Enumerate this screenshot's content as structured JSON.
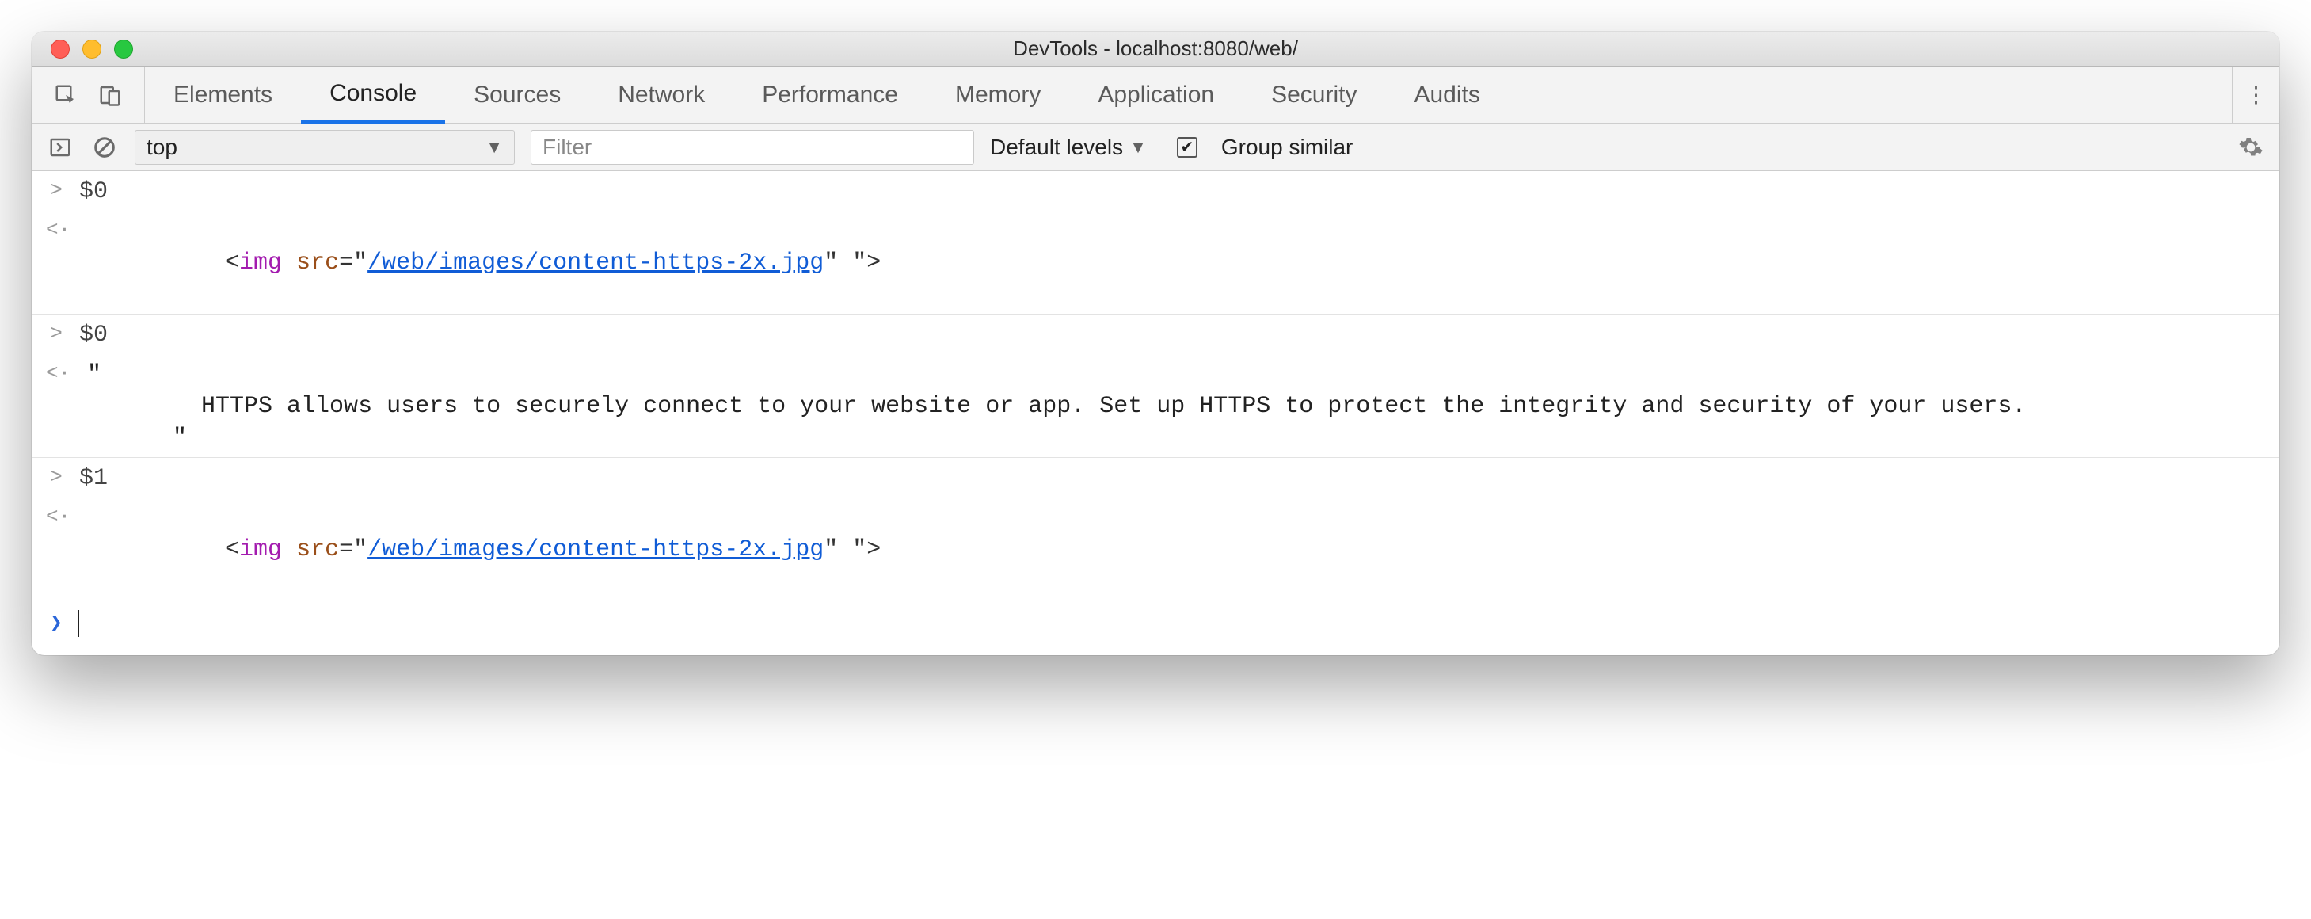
{
  "window": {
    "title": "DevTools - localhost:8080/web/"
  },
  "tabs": {
    "elements": "Elements",
    "console": "Console",
    "sources": "Sources",
    "network": "Network",
    "performance": "Performance",
    "memory": "Memory",
    "application": "Application",
    "security": "Security",
    "audits": "Audits"
  },
  "toolbar": {
    "context": "top",
    "filter_placeholder": "Filter",
    "levels": "Default levels",
    "group_similar": "Group similar"
  },
  "glyphs": {
    "input": ">",
    "output": "<·",
    "prompt": "❯",
    "caret": "▼",
    "check": "✔",
    "kebab": "⋮"
  },
  "entries": [
    {
      "kind": "input",
      "text": "$0"
    },
    {
      "kind": "output_html",
      "tag": "img",
      "attr": "src",
      "q": "\"",
      "url": "/web/images/content-https-2x.jpg",
      "tail": "\" \">"
    },
    {
      "kind": "input",
      "text": "$0"
    },
    {
      "kind": "output_text",
      "text": "\"\n        HTTPS allows users to securely connect to your website or app. Set up HTTPS to protect the integrity and security of your users.\n      \""
    },
    {
      "kind": "input",
      "text": "$1"
    },
    {
      "kind": "output_html",
      "tag": "img",
      "attr": "src",
      "q": "\"",
      "url": "/web/images/content-https-2x.jpg",
      "tail": "\" \">"
    }
  ]
}
